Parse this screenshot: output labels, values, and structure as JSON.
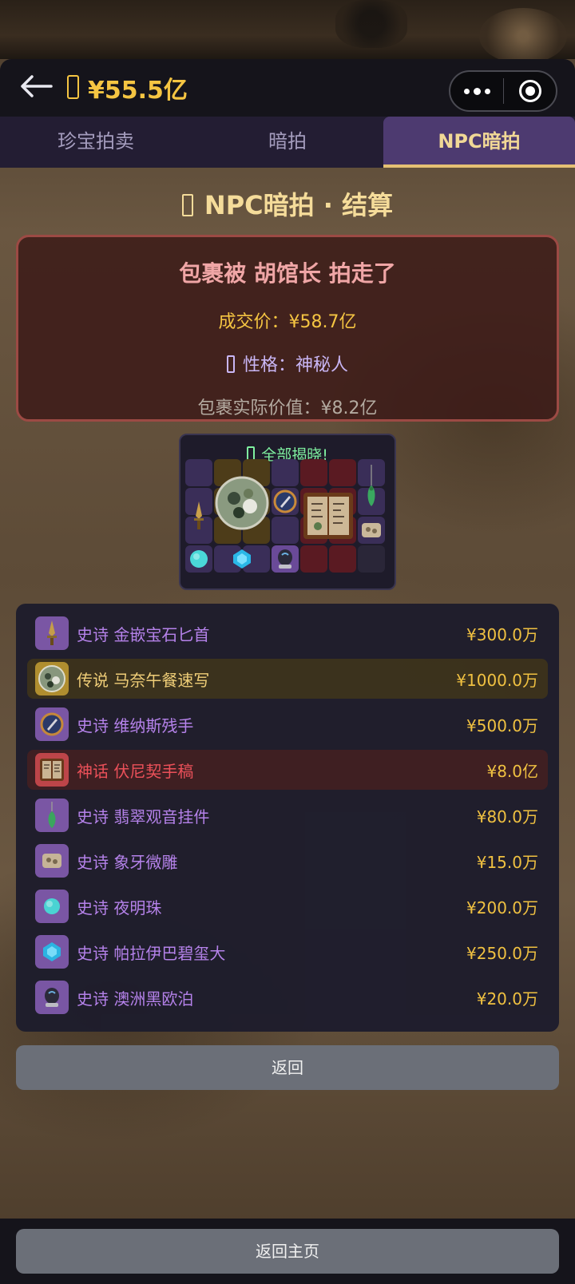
{
  "header": {
    "money": "¥55.5亿",
    "back_icon": "arrow-left-icon",
    "coin_icon": "coin-icon",
    "more_icon": "more-dots-icon",
    "record_icon": "target-icon"
  },
  "tabs": [
    {
      "label": "珍宝拍卖",
      "active": false
    },
    {
      "label": "暗拍",
      "active": false
    },
    {
      "label": "NPC暗拍",
      "active": true
    }
  ],
  "page_title": "NPC暗拍 · 结算",
  "result": {
    "summary": "包裹被 胡馆长 拍走了",
    "deal_price": "成交价：¥58.7亿",
    "personality": "性格：神秘人",
    "actual_value": "包裹实际价值：¥8.2亿"
  },
  "grid": {
    "reveal_text": "全部揭晓!"
  },
  "items": [
    {
      "rarity": "史诗",
      "name": "金嵌宝石匕首",
      "price": "¥300.0万",
      "tier": "epic",
      "icon": "dagger-icon"
    },
    {
      "rarity": "传说",
      "name": "马奈午餐速写",
      "price": "¥1000.0万",
      "tier": "legend",
      "icon": "painting-icon"
    },
    {
      "rarity": "史诗",
      "name": "维纳斯残手",
      "price": "¥500.0万",
      "tier": "epic",
      "icon": "statue-hand-icon"
    },
    {
      "rarity": "神话",
      "name": "伏尼契手稿",
      "price": "¥8.0亿",
      "tier": "myth",
      "icon": "manuscript-icon"
    },
    {
      "rarity": "史诗",
      "name": "翡翠观音挂件",
      "price": "¥80.0万",
      "tier": "epic",
      "icon": "jade-pendant-icon"
    },
    {
      "rarity": "史诗",
      "name": "象牙微雕",
      "price": "¥15.0万",
      "tier": "epic",
      "icon": "ivory-carving-icon"
    },
    {
      "rarity": "史诗",
      "name": "夜明珠",
      "price": "¥200.0万",
      "tier": "epic",
      "icon": "pearl-icon"
    },
    {
      "rarity": "史诗",
      "name": "帕拉伊巴碧玺大",
      "price": "¥250.0万",
      "tier": "epic",
      "icon": "gem-icon"
    },
    {
      "rarity": "史诗",
      "name": "澳洲黑欧泊",
      "price": "¥20.0万",
      "tier": "epic",
      "icon": "black-opal-icon"
    }
  ],
  "buttons": {
    "back": "返回",
    "home": "返回主页"
  },
  "colors": {
    "epic": "#b884f0",
    "legend": "#f5d37a",
    "myth": "#f0505a",
    "gold": "#f5c542"
  }
}
